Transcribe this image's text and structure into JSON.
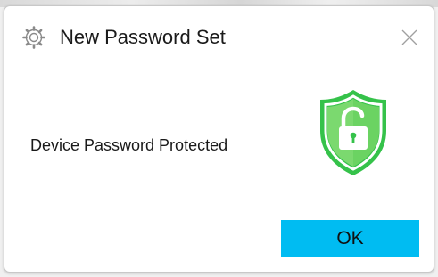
{
  "dialog": {
    "title": "New Password Set",
    "app_icon": "gear-icon",
    "close_icon": "close-icon",
    "message": "Device Password Protected",
    "status_icon": "shield-unlocked-padlock-icon",
    "ok_label": "OK"
  },
  "colors": {
    "ok_button": "#00bcf2",
    "shield_outer": "#35c24a",
    "shield_inner": "#7bd96f",
    "shield_border": "#ffffff"
  }
}
